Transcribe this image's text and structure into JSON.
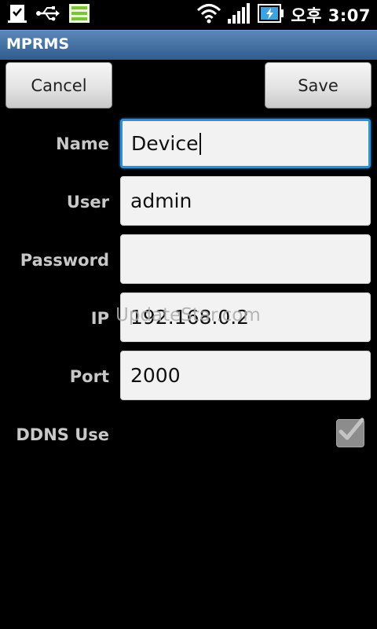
{
  "status_bar": {
    "time": "오후 3:07",
    "icons": [
      "usb-debug-icon",
      "usb-icon",
      "storage-icon",
      "wifi-icon",
      "signal-icon",
      "battery-charging-icon"
    ]
  },
  "app": {
    "title": "MPRMS"
  },
  "toolbar": {
    "cancel_label": "Cancel",
    "save_label": "Save"
  },
  "form": {
    "name_label": "Name",
    "name_value": "Device",
    "user_label": "User",
    "user_value": "admin",
    "password_label": "Password",
    "password_value": "",
    "ip_label": "IP",
    "ip_value": "192.168.0.2",
    "port_label": "Port",
    "port_value": "2000",
    "ddns_label": "DDNS Use",
    "ddns_checked": true
  },
  "watermark": "UpdateStar.com",
  "colors": {
    "titlebar": "#2f5b8f",
    "focus": "#2f8fd6",
    "label": "#c8c8c8"
  }
}
